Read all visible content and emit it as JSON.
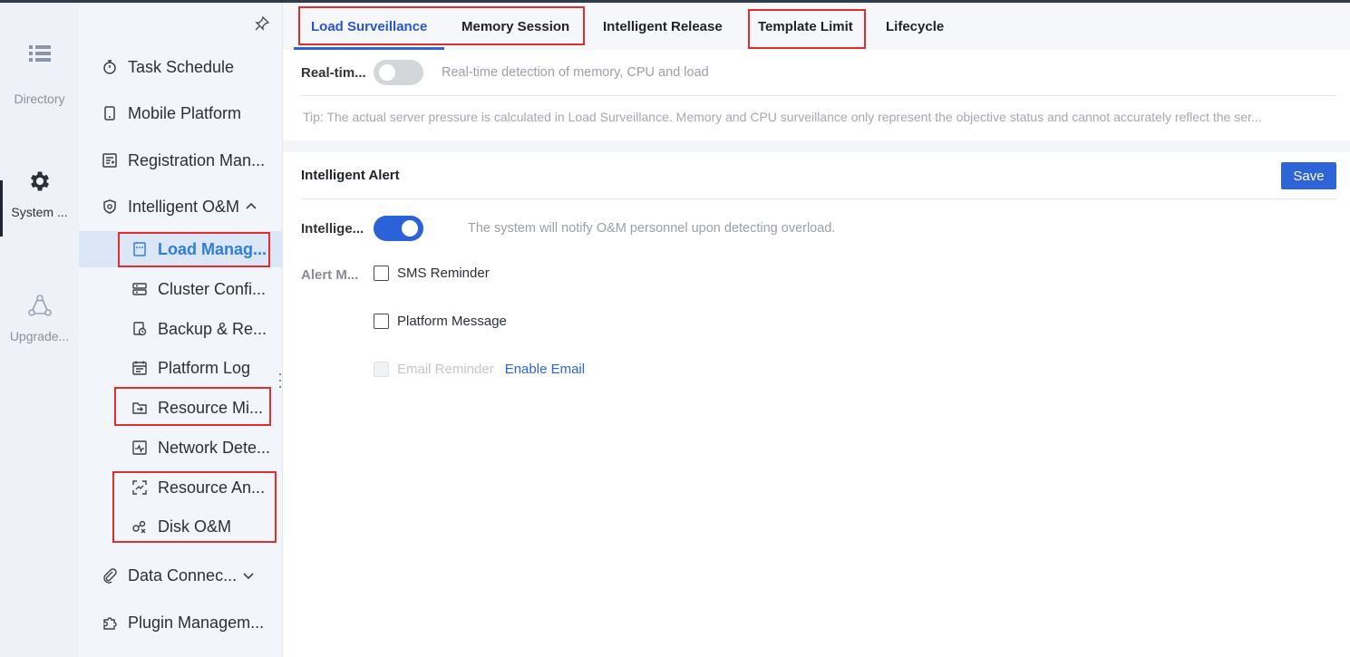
{
  "rail": {
    "items": [
      {
        "label": "Directory",
        "icon": "list-icon"
      },
      {
        "label": "System ...",
        "icon": "gear-icon",
        "active": true
      },
      {
        "label": "Upgrade...",
        "icon": "upgrade-icon"
      }
    ]
  },
  "sidebar": {
    "items": [
      {
        "label": "Task Schedule",
        "icon": "stopwatch-icon"
      },
      {
        "label": "Mobile Platform",
        "icon": "mobile-icon"
      },
      {
        "label": "Registration Man...",
        "icon": "registration-icon"
      },
      {
        "label": "Intelligent O&M",
        "icon": "om-shield-icon",
        "expanded": true
      },
      {
        "label": "Load Manag...",
        "icon": "load-icon",
        "active": true
      },
      {
        "label": "Cluster Confi...",
        "icon": "cluster-icon"
      },
      {
        "label": "Backup & Re...",
        "icon": "backup-icon"
      },
      {
        "label": "Platform Log",
        "icon": "log-icon"
      },
      {
        "label": "Resource Mi...",
        "icon": "migration-icon"
      },
      {
        "label": "Network Dete...",
        "icon": "network-icon"
      },
      {
        "label": "Resource An...",
        "icon": "analysis-icon"
      },
      {
        "label": "Disk O&M",
        "icon": "disk-icon"
      },
      {
        "label": "Data Connec...",
        "icon": "paperclip-icon",
        "expanded": false
      },
      {
        "label": "Plugin Managem...",
        "icon": "puzzle-icon"
      }
    ]
  },
  "tabs": [
    {
      "label": "Load Surveillance",
      "active": true
    },
    {
      "label": "Memory Session"
    },
    {
      "label": "Intelligent Release"
    },
    {
      "label": "Template Limit"
    },
    {
      "label": "Lifecycle"
    }
  ],
  "realtime": {
    "label": "Real-tim...",
    "enabled": false,
    "hint": "Real-time detection of memory, CPU and load"
  },
  "tip": "Tip: The actual server pressure is calculated in Load Surveillance. Memory and CPU surveillance only represent the objective status and cannot accurately reflect the ser...",
  "alert": {
    "title": "Intelligent Alert",
    "save_label": "Save",
    "toggle_label": "Intellige...",
    "enabled": true,
    "hint": "The system will notify O&M personnel upon detecting overload.",
    "method_label": "Alert M...",
    "options": [
      {
        "label": "SMS Reminder",
        "checked": false,
        "disabled": false
      },
      {
        "label": "Platform Message",
        "checked": false,
        "disabled": false
      },
      {
        "label": "Email Reminder",
        "checked": false,
        "disabled": true
      }
    ],
    "enable_email_link": "Enable Email"
  },
  "colors": {
    "accent": "#2f64d8",
    "active_menu_text": "#2f7de1",
    "highlight_box": "#e02e2e"
  }
}
